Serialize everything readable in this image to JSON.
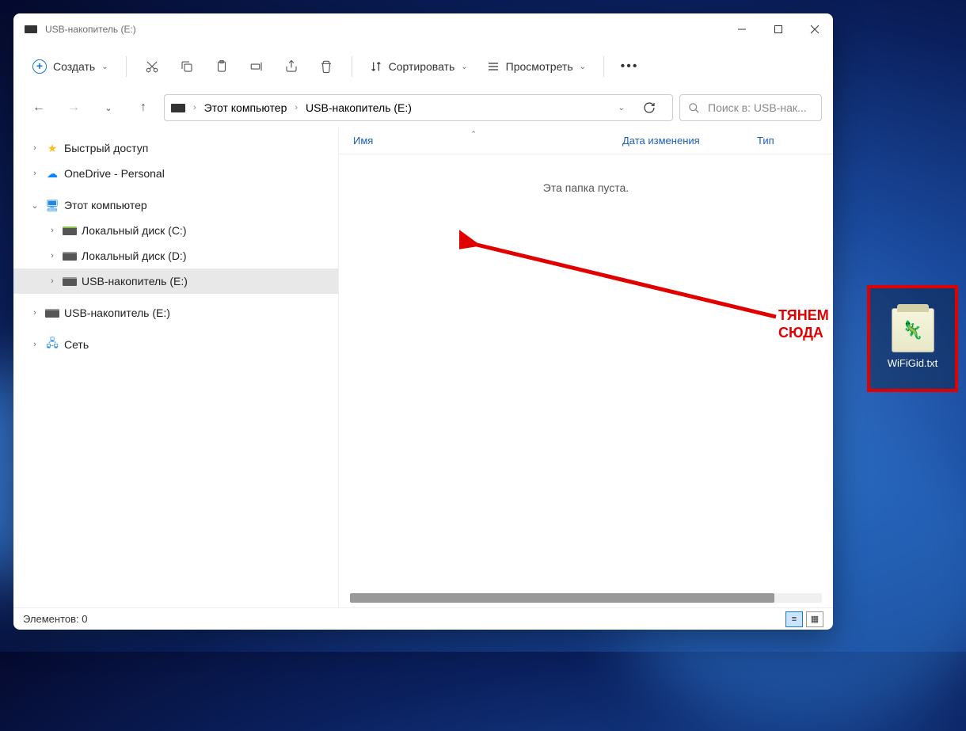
{
  "titlebar": {
    "title": "USB-накопитель (E:)"
  },
  "toolbar": {
    "create": "Создать",
    "sort": "Сортировать",
    "view": "Просмотреть"
  },
  "breadcrumb": {
    "root": "Этот компьютер",
    "current": "USB-накопитель (E:)"
  },
  "search": {
    "placeholder": "Поиск в: USB-нак..."
  },
  "sidebar": {
    "items": [
      {
        "label": "Быстрый доступ",
        "icon": "star",
        "level": 1,
        "expand": "›"
      },
      {
        "label": "OneDrive - Personal",
        "icon": "cloud",
        "level": 1,
        "expand": "›"
      },
      {
        "label": "Этот компьютер",
        "icon": "monitor",
        "level": 1,
        "expand": "⌄"
      },
      {
        "label": "Локальный диск (C:)",
        "icon": "disk-green",
        "level": 2,
        "expand": "›"
      },
      {
        "label": "Локальный диск (D:)",
        "icon": "disk",
        "level": 2,
        "expand": "›"
      },
      {
        "label": "USB-накопитель (E:)",
        "icon": "disk",
        "level": 2,
        "expand": "›",
        "selected": true
      },
      {
        "label": "USB-накопитель (E:)",
        "icon": "disk",
        "level": 1,
        "expand": "›"
      },
      {
        "label": "Сеть",
        "icon": "net",
        "level": 1,
        "expand": "›"
      }
    ]
  },
  "columns": {
    "name": "Имя",
    "date": "Дата изменения",
    "type": "Тип"
  },
  "main": {
    "empty_text": "Эта папка пуста."
  },
  "status": {
    "text": "Элементов: 0"
  },
  "annotation": {
    "line1": "ТЯНЕМ",
    "line2": "СЮДА"
  },
  "desktop_file": {
    "name": "WiFiGid.txt"
  }
}
